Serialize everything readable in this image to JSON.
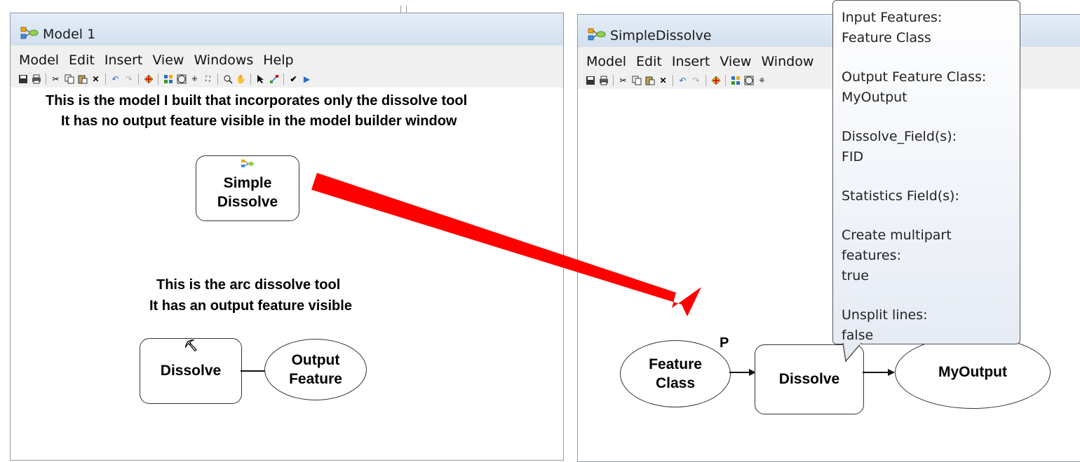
{
  "left_window": {
    "title": "Model 1",
    "menu": [
      "Model",
      "Edit",
      "Insert",
      "View",
      "Windows",
      "Help"
    ],
    "note_top_line1": "This is the model I built that incorporates only the dissolve tool",
    "note_top_line2": "It has no output feature visible in the model builder window",
    "simple_dissolve_label": "Simple\nDissolve",
    "note_bottom_line1": "This is the arc dissolve tool",
    "note_bottom_line2": "It has an output feature visible",
    "dissolve_label": "Dissolve",
    "output_feature_label": "Output\nFeature"
  },
  "right_window": {
    "title": "SimpleDissolve",
    "menu": [
      "Model",
      "Edit",
      "Insert",
      "View",
      "Window"
    ],
    "feature_class_label": "Feature\nClass",
    "p_marker": "P",
    "dissolve_label": "Dissolve",
    "myoutput_label": "MyOutput"
  },
  "tooltip": {
    "items": [
      {
        "label": "Input Features:",
        "value": "Feature Class"
      },
      {
        "label": "Output Feature Class:",
        "value": "MyOutput"
      },
      {
        "label": "Dissolve_Field(s):",
        "value": "FID"
      },
      {
        "label": "Statistics Field(s):",
        "value": ""
      },
      {
        "label": "Create multipart features:",
        "value": "true"
      },
      {
        "label": "Unsplit lines:",
        "value": "false"
      }
    ]
  },
  "toolbar_icons": [
    "save-icon",
    "print-icon",
    "cut-icon",
    "copy-icon",
    "paste-icon",
    "delete-icon",
    "undo-icon",
    "redo-icon",
    "add-data-icon",
    "auto-layout-icon",
    "full-extent-icon",
    "fixed-zoom-in-icon",
    "fixed-zoom-out-icon",
    "zoom-in-icon",
    "pan-icon",
    "select-icon",
    "connect-icon",
    "validate-icon",
    "run-icon"
  ],
  "colors": {
    "arrow": "#ff0000",
    "titlebar": "#dde8f3",
    "menubar": "#f0f0f0",
    "tooltip_bg": "#eef2f8"
  }
}
